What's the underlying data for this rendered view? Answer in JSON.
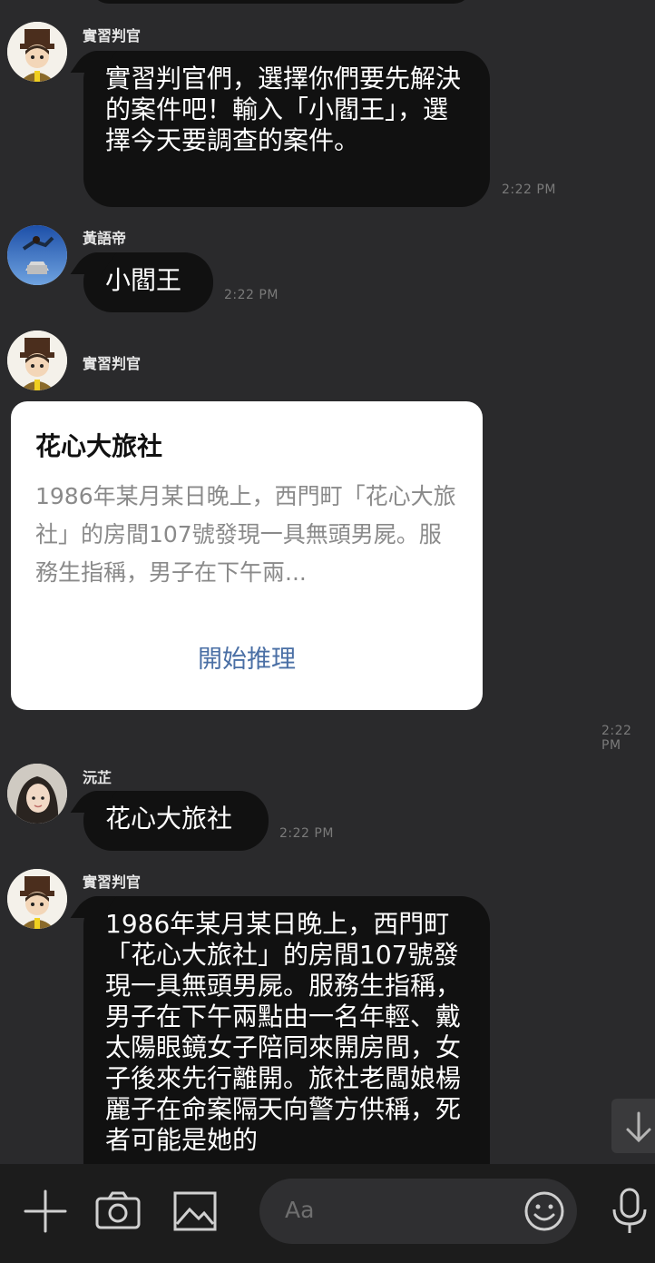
{
  "messages": [
    {
      "sender": "實習判官",
      "text": "實習判官們，選擇你們要先解決的案件吧！輸入「小閻王」，選擇今天要調查的案件。",
      "time": "2:22 PM"
    },
    {
      "sender": "黃語帝",
      "text": "小閻王",
      "time": "2:22 PM"
    },
    {
      "sender": "實習判官",
      "card": {
        "title": "花心大旅社",
        "body": "1986年某月某日晚上，西門町「花心大旅社」的房間107號發現一具無頭男屍。服務生指稱，男子在下午兩...",
        "button": "開始推理"
      },
      "time": "2:22 PM"
    },
    {
      "sender": "沅芷",
      "text": "花心大旅社",
      "time": "2:22 PM"
    },
    {
      "sender": "實習判官",
      "text": "1986年某月某日晚上，西門町「花心大旅社」的房間107號發現一具無頭男屍。服務生指稱，男子在下午兩點由一名年輕、戴太陽眼鏡女子陪同來開房間，女子後來先行離開。旅社老闆娘楊麗子在命案隔天向警方供稱，死者可能是她的"
    }
  ],
  "composer": {
    "placeholder": "Aa"
  },
  "icons": [
    "plus-icon",
    "camera-icon",
    "image-icon",
    "emoji-icon",
    "microphone-icon",
    "arrow-down-icon"
  ],
  "colors": {
    "background": "#2a2a2c",
    "bubble": "#111111",
    "card_button": "#4a6fa5",
    "bottom_bar": "#1c1c1c"
  }
}
